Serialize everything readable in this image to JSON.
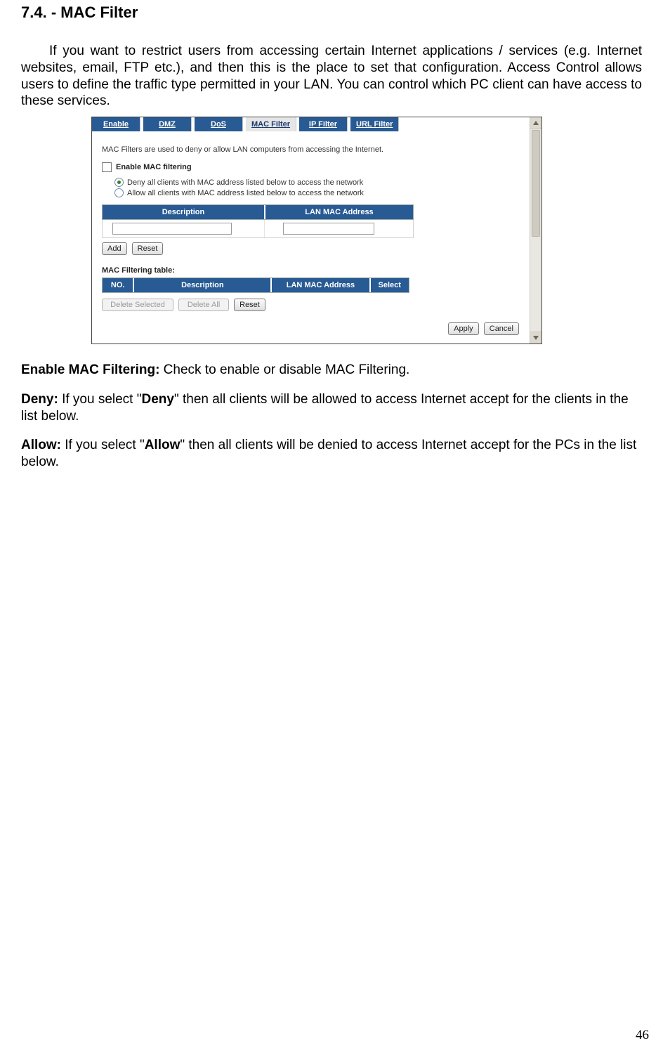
{
  "doc": {
    "section_number": "7.4.",
    "section_title": "- MAC Filter",
    "intro_text": "If you want to restrict users from accessing certain Internet applications / services (e.g. Internet websites, email, FTP etc.), and then this is the place to set that configuration. Access Control allows users to define the traffic type permitted in your LAN. You can control which PC client can have access to these services.",
    "def1_term": "Enable MAC Filtering:",
    "def1_text": " Check to enable or disable MAC Filtering.",
    "def2_term": "Deny:",
    "def2_text1": " If you select \"",
    "def2_bold": "Deny",
    "def2_text2": "\" then all clients will be allowed to access Internet accept for the clients in the list below.",
    "def3_term": "Allow:",
    "def3_text1": " If you select \"",
    "def3_bold": "Allow",
    "def3_text2": "\" then all clients will be denied to access Internet accept for the PCs in the list below.",
    "page_number": "46"
  },
  "ui": {
    "tabs": {
      "enable": "Enable",
      "dmz": "DMZ",
      "dos": "DoS",
      "mac_filter": "MAC Filter",
      "ip_filter": "IP Filter",
      "url_filter": "URL Filter"
    },
    "help_text": "MAC Filters are used to deny or allow LAN computers from accessing the Internet.",
    "enable_label": "Enable MAC filtering",
    "radio_deny": "Deny all clients with MAC address listed below to access the network",
    "radio_allow": "Allow all clients with MAC address listed below to access the network",
    "col_description": "Description",
    "col_mac": "LAN MAC Address",
    "btn_add": "Add",
    "btn_reset": "Reset",
    "table_title": "MAC Filtering table:",
    "fcol_no": "NO.",
    "fcol_desc": "Description",
    "fcol_mac": "LAN MAC Address",
    "fcol_select": "Select",
    "btn_delete_selected": "Delete Selected",
    "btn_delete_all": "Delete All",
    "btn_reset2": "Reset",
    "btn_apply": "Apply",
    "btn_cancel": "Cancel"
  }
}
